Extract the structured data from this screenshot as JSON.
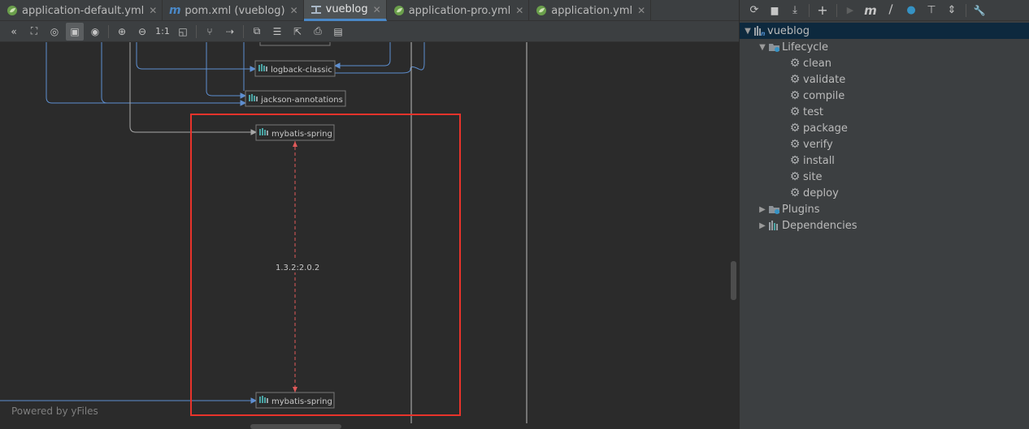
{
  "tabs": [
    {
      "label": "application-default.yml",
      "icon": "spring-leaf-icon",
      "close": "✕",
      "active": false
    },
    {
      "label": "pom.xml (vueblog)",
      "icon": "maven-m-icon",
      "close": "✕",
      "active": false
    },
    {
      "label": "vueblog",
      "icon": "diagram-icon",
      "close": "✕",
      "active": true
    },
    {
      "label": "application-pro.yml",
      "icon": "spring-leaf-icon",
      "close": "✕",
      "active": false
    },
    {
      "label": "application.yml",
      "icon": "spring-leaf-icon",
      "close": "✕",
      "active": false
    }
  ],
  "diagram_toolbar": [
    {
      "name": "collapse-icon",
      "glyph": "«"
    },
    {
      "name": "hierarchy-icon",
      "glyph": "⛶"
    },
    {
      "name": "focus-icon",
      "glyph": "◎"
    },
    {
      "name": "fit-icon",
      "glyph": "▣",
      "active": true
    },
    {
      "name": "eye-icon",
      "glyph": "◉"
    },
    {
      "name": "zoom-in-icon",
      "glyph": "⊕"
    },
    {
      "name": "zoom-out-icon",
      "glyph": "⊖"
    },
    {
      "name": "actual-size-icon",
      "glyph": "1:1"
    },
    {
      "name": "fit-content-icon",
      "glyph": "◱"
    },
    {
      "name": "layout-icon",
      "glyph": "⑂"
    },
    {
      "name": "route-edges-icon",
      "glyph": "⇢"
    },
    {
      "name": "copy-icon",
      "glyph": "⧉"
    },
    {
      "name": "properties-icon",
      "glyph": "☰"
    },
    {
      "name": "export-icon",
      "glyph": "⇱"
    },
    {
      "name": "print-icon",
      "glyph": "⎙"
    },
    {
      "name": "save-icon",
      "glyph": "▤"
    }
  ],
  "diagram": {
    "nodes": {
      "logback": "logback-classic",
      "jackson": "jackson-annotations",
      "mybatis_top": "mybatis-spring",
      "mybatis_bottom": "mybatis-spring"
    },
    "conflict_label": "1.3.2:2.0.2",
    "colors": {
      "edge": "#5e8fd0",
      "conflict": "#e05a5a",
      "selection": "#e8332b"
    }
  },
  "powered_by": "Powered by yFiles",
  "maven": {
    "toolbar": [
      {
        "name": "reload-icon",
        "glyph": "⟳"
      },
      {
        "name": "add-folder-icon",
        "glyph": "▆"
      },
      {
        "name": "download-icon",
        "glyph": "⤓"
      },
      {
        "name": "add-icon",
        "glyph": "+"
      },
      {
        "name": "run-icon",
        "glyph": "▶",
        "disabled": true
      },
      {
        "name": "maven-goal-icon",
        "glyph": "m"
      },
      {
        "name": "skip-tests-icon",
        "glyph": "⧸"
      },
      {
        "name": "offline-icon",
        "glyph": "●"
      },
      {
        "name": "show-dependencies-icon",
        "glyph": "⊤"
      },
      {
        "name": "collapse-all-icon",
        "glyph": "⇕"
      },
      {
        "name": "settings-icon",
        "glyph": "🔧"
      }
    ],
    "project": "vueblog",
    "lifecycle_label": "Lifecycle",
    "lifecycle": [
      "clean",
      "validate",
      "compile",
      "test",
      "package",
      "verify",
      "install",
      "site",
      "deploy"
    ],
    "plugins_label": "Plugins",
    "dependencies_label": "Dependencies"
  }
}
